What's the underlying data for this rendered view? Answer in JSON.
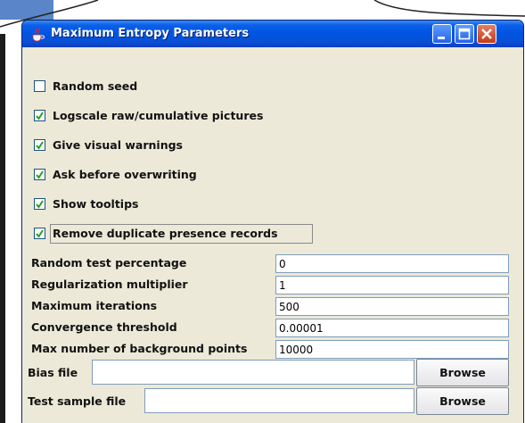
{
  "window": {
    "title": "Maximum Entropy Parameters",
    "title_bar_color": "#0054e3",
    "icons": {
      "app": "java-cup-icon",
      "minimize": "minimize-icon",
      "maximize": "maximize-icon",
      "close": "close-icon"
    }
  },
  "checkboxes": [
    {
      "label": "Random seed",
      "checked": false
    },
    {
      "label": "Logscale raw/cumulative pictures",
      "checked": true
    },
    {
      "label": "Give visual warnings",
      "checked": true
    },
    {
      "label": "Ask before overwriting",
      "checked": true
    },
    {
      "label": "Show tooltips",
      "checked": true
    },
    {
      "label": "Remove duplicate presence records",
      "checked": true,
      "focused": true
    }
  ],
  "parameters": [
    {
      "label": "Random test percentage",
      "value": "0"
    },
    {
      "label": "Regularization multiplier",
      "value": "1"
    },
    {
      "label": "Maximum iterations",
      "value": "500"
    },
    {
      "label": "Convergence threshold",
      "value": "0.00001"
    },
    {
      "label": "Max number of background points",
      "value": "10000"
    }
  ],
  "files": [
    {
      "label": "Bias file",
      "value": "",
      "button": "Browse"
    },
    {
      "label": "Test sample file",
      "value": "",
      "button": "Browse"
    }
  ]
}
